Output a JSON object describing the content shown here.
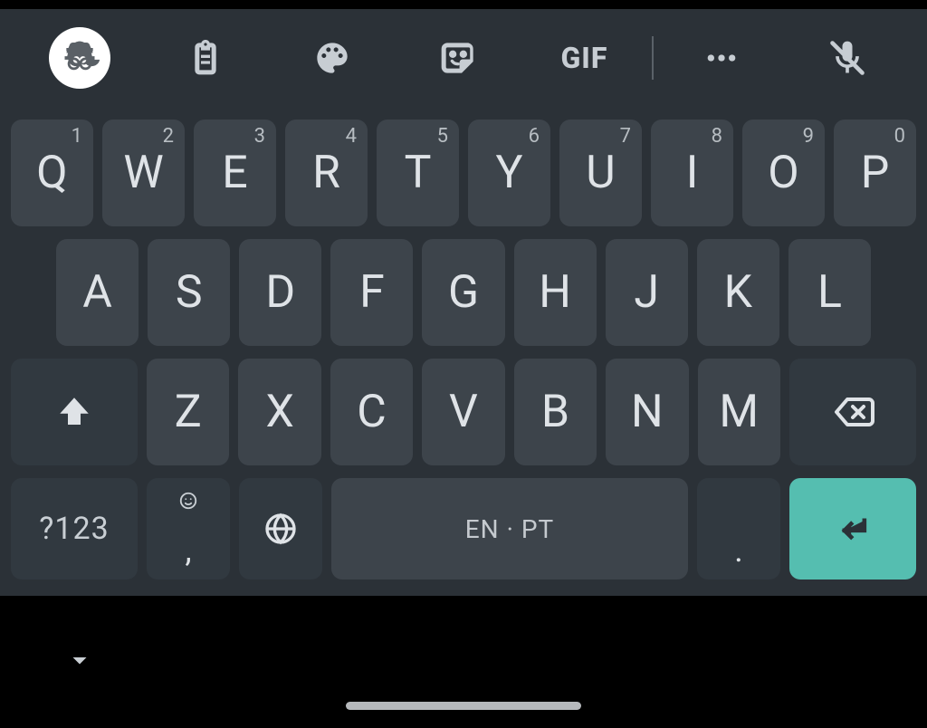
{
  "toolbar": {
    "incognito": "incognito",
    "clipboard": "clipboard",
    "theme": "theme",
    "sticker": "sticker",
    "gif_label": "GIF",
    "more": "more",
    "mic": "voice-input"
  },
  "rows": {
    "r1": [
      {
        "k": "Q",
        "h": "1"
      },
      {
        "k": "W",
        "h": "2"
      },
      {
        "k": "E",
        "h": "3"
      },
      {
        "k": "R",
        "h": "4"
      },
      {
        "k": "T",
        "h": "5"
      },
      {
        "k": "Y",
        "h": "6"
      },
      {
        "k": "U",
        "h": "7"
      },
      {
        "k": "I",
        "h": "8"
      },
      {
        "k": "O",
        "h": "9"
      },
      {
        "k": "P",
        "h": "0"
      }
    ],
    "r2": [
      {
        "k": "A"
      },
      {
        "k": "S"
      },
      {
        "k": "D"
      },
      {
        "k": "F"
      },
      {
        "k": "G"
      },
      {
        "k": "H"
      },
      {
        "k": "J"
      },
      {
        "k": "K"
      },
      {
        "k": "L"
      }
    ],
    "r3": [
      {
        "k": "Z"
      },
      {
        "k": "X"
      },
      {
        "k": "C"
      },
      {
        "k": "V"
      },
      {
        "k": "B"
      },
      {
        "k": "N"
      },
      {
        "k": "M"
      }
    ]
  },
  "bottom": {
    "symbols": "?123",
    "emoji_hint": "☺",
    "emoji_main": ",",
    "space_label": "EN · PT",
    "period_main": ".",
    "enter": "enter"
  },
  "nav": {
    "collapse": "collapse-keyboard"
  },
  "colors": {
    "accent": "#55beb0",
    "key": "#3d444b",
    "fnkey": "#313940",
    "bg": "#2b3137"
  }
}
